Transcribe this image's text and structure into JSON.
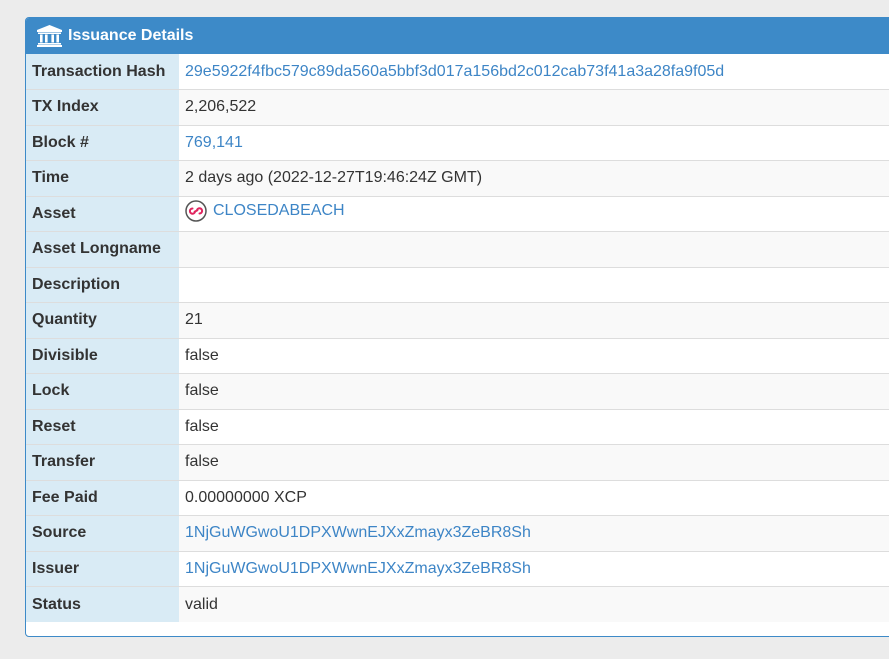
{
  "panel": {
    "title": "Issuance Details",
    "icon": "bank-icon",
    "header_color": "#3d8ac8",
    "label_bg": "#d9ebf5",
    "link_color": "#3d85c6"
  },
  "rows": [
    {
      "label": "Transaction Hash",
      "value": "29e5922f4fbc579c89da560a5bbf3d017a156bd2c012cab73f41a3a28fa9f05d"
    },
    {
      "label": "TX Index",
      "value": "2,206,522"
    },
    {
      "label": "Block #",
      "value": "769,141"
    },
    {
      "label": "Time",
      "value": "2 days ago (2022-12-27T19:46:24Z GMT)"
    },
    {
      "label": "Asset",
      "value": "CLOSEDABEACH",
      "icon": "asset-logo-icon"
    },
    {
      "label": "Asset Longname",
      "value": ""
    },
    {
      "label": "Description",
      "value": ""
    },
    {
      "label": "Quantity",
      "value": "21"
    },
    {
      "label": "Divisible",
      "value": "false"
    },
    {
      "label": "Lock",
      "value": "false"
    },
    {
      "label": "Reset",
      "value": "false"
    },
    {
      "label": "Transfer",
      "value": "false"
    },
    {
      "label": "Fee Paid",
      "value": "0.00000000 XCP"
    },
    {
      "label": "Source",
      "value": "1NjGuWGwoU1DPXWwnEJXxZmayx3ZeBR8Sh"
    },
    {
      "label": "Issuer",
      "value": "1NjGuWGwoU1DPXWwnEJXxZmayx3ZeBR8Sh"
    },
    {
      "label": "Status",
      "value": "valid"
    }
  ]
}
